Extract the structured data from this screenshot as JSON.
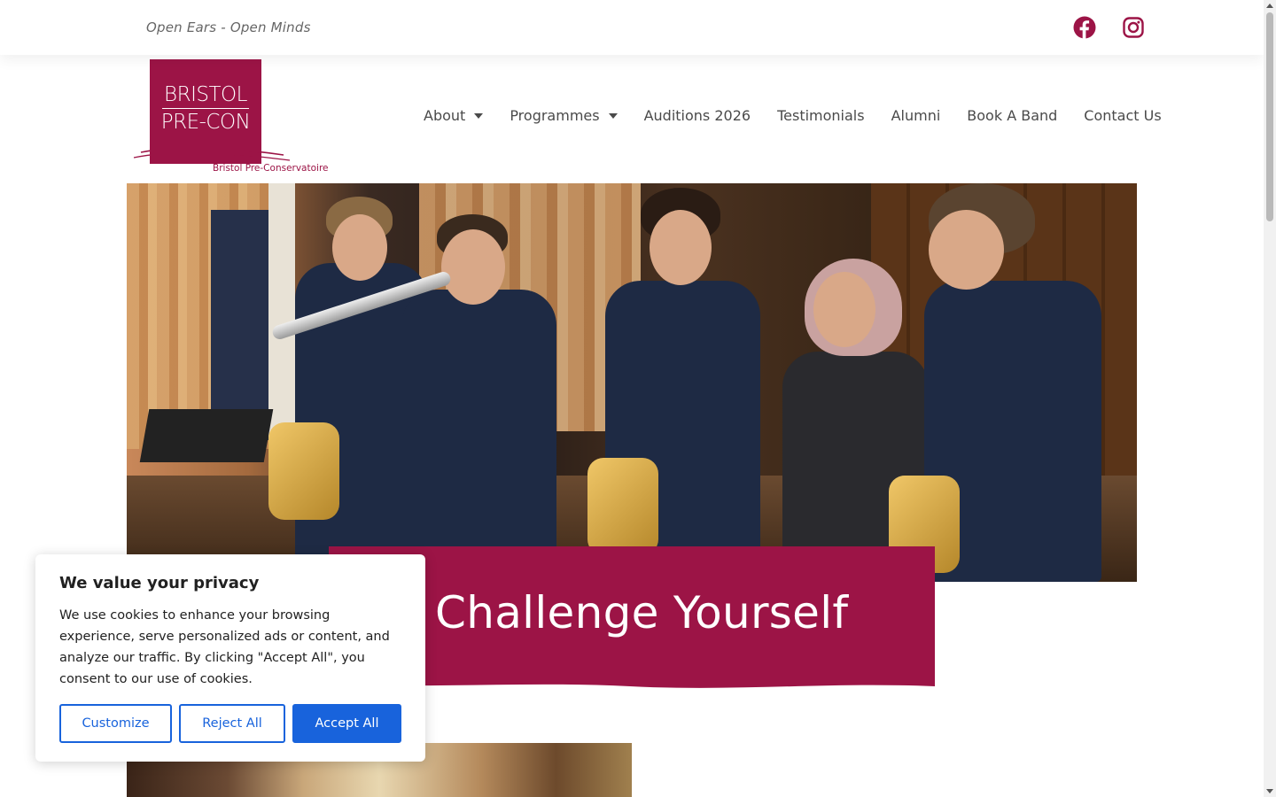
{
  "topbar": {
    "tagline": "Open Ears - Open Minds",
    "social": [
      {
        "name": "facebook-icon",
        "color": "#9c1446"
      },
      {
        "name": "instagram-icon",
        "color": "#9c1446"
      }
    ]
  },
  "logo": {
    "line1": "BRISTOL",
    "line2": "PRE-CON",
    "subtitle": "Bristol Pre-Conservatoire",
    "brand_color": "#9c1446"
  },
  "nav": {
    "items": [
      {
        "label": "About",
        "has_dropdown": true
      },
      {
        "label": "Programmes",
        "has_dropdown": true
      },
      {
        "label": "Auditions 2026",
        "has_dropdown": false
      },
      {
        "label": "Testimonials",
        "has_dropdown": false
      },
      {
        "label": "Alumni",
        "has_dropdown": false
      },
      {
        "label": "Book A Band",
        "has_dropdown": false
      },
      {
        "label": "Contact Us",
        "has_dropdown": false
      }
    ]
  },
  "hero": {
    "banner_text": "Challenge Yourself",
    "banner_color": "#9c1446"
  },
  "cookie_dialog": {
    "title": "We value your privacy",
    "text": "We use cookies to enhance your browsing experience, serve personalized ads or content, and analyze our traffic. By clicking \"Accept All\", you consent to our use of cookies.",
    "buttons": {
      "customize": "Customize",
      "reject": "Reject All",
      "accept": "Accept All"
    },
    "accent_color": "#1863dc"
  }
}
